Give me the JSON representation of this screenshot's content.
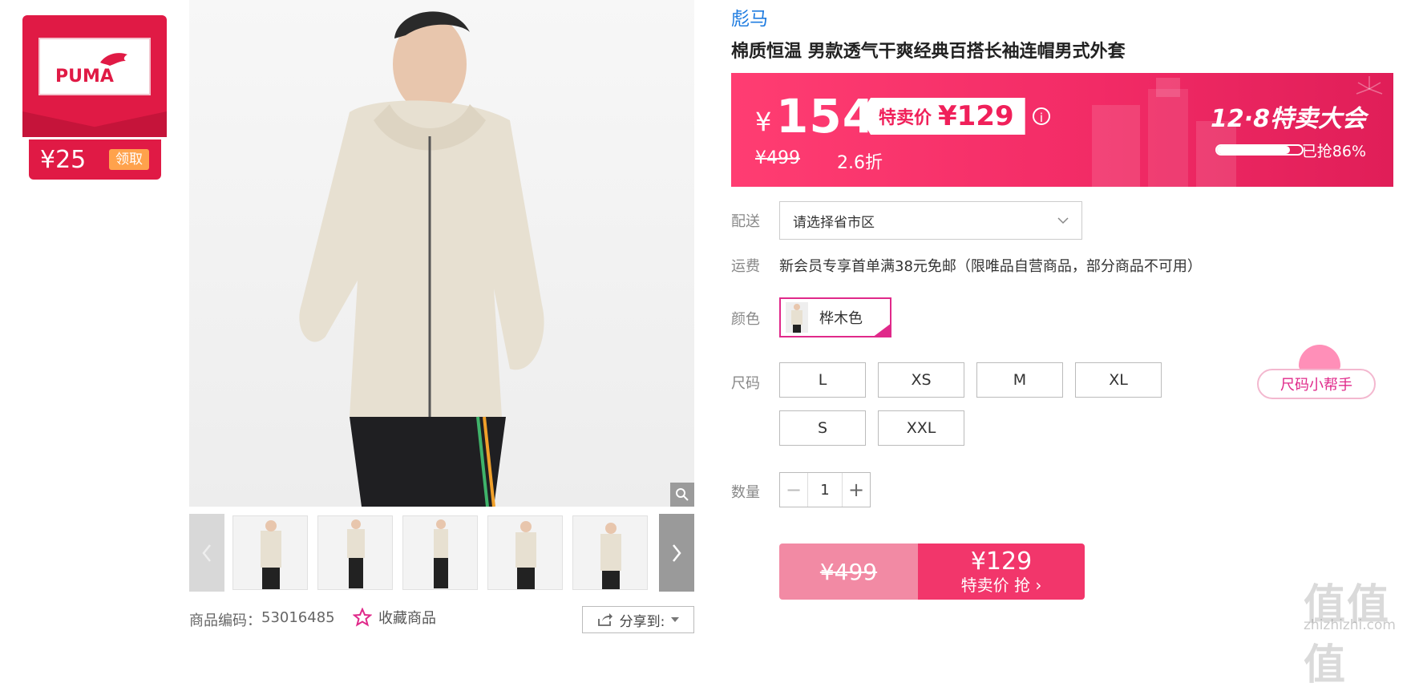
{
  "coupon": {
    "brand_logo": "PUMA",
    "amount": "¥25",
    "claim_label": "领取"
  },
  "gallery": {
    "zoom_icon": "magnifier-icon",
    "prev_icon": "chevron-left-icon",
    "next_icon": "chevron-right-icon",
    "thumbnail_count": 5
  },
  "meta": {
    "code_label": "商品编码：",
    "code": "53016485",
    "favorite_label": "收藏商品",
    "share_label": "分享到:"
  },
  "product": {
    "brand": "彪马",
    "title": "棉质恒温 男款透气干爽经典百搭长袖连帽男式外套"
  },
  "price": {
    "currency": "¥",
    "current": "154",
    "sale_label": "特卖价",
    "sale_price": "¥129",
    "original": "¥499",
    "discount": "2.6折",
    "event_title": "12·8特卖大会",
    "sold_text": "已抢86%",
    "sold_fraction": 0.86
  },
  "delivery": {
    "label": "配送",
    "placeholder": "请选择省市区"
  },
  "shipping": {
    "label": "运费",
    "text": "新会员专享首单满38元免邮（限唯品自营商品，部分商品不可用）"
  },
  "color": {
    "label": "颜色",
    "selected": "桦木色"
  },
  "size": {
    "label": "尺码",
    "options": [
      "L",
      "XS",
      "M",
      "XL",
      "S",
      "XXL"
    ],
    "helper_label": "尺码小帮手"
  },
  "quantity": {
    "label": "数量",
    "minus": "−",
    "value": "1",
    "plus": "+"
  },
  "buy": {
    "original": "¥499",
    "price": "¥129",
    "cta": "特卖价 抢 ›"
  },
  "watermark": {
    "cn": "值值值",
    "en": "zhizhizhi.com"
  },
  "colors": {
    "brand_red": "#e01a45",
    "banner_pink": "#f22b66",
    "accent_magenta": "#e0298a",
    "link_blue": "#1f7ce0"
  }
}
